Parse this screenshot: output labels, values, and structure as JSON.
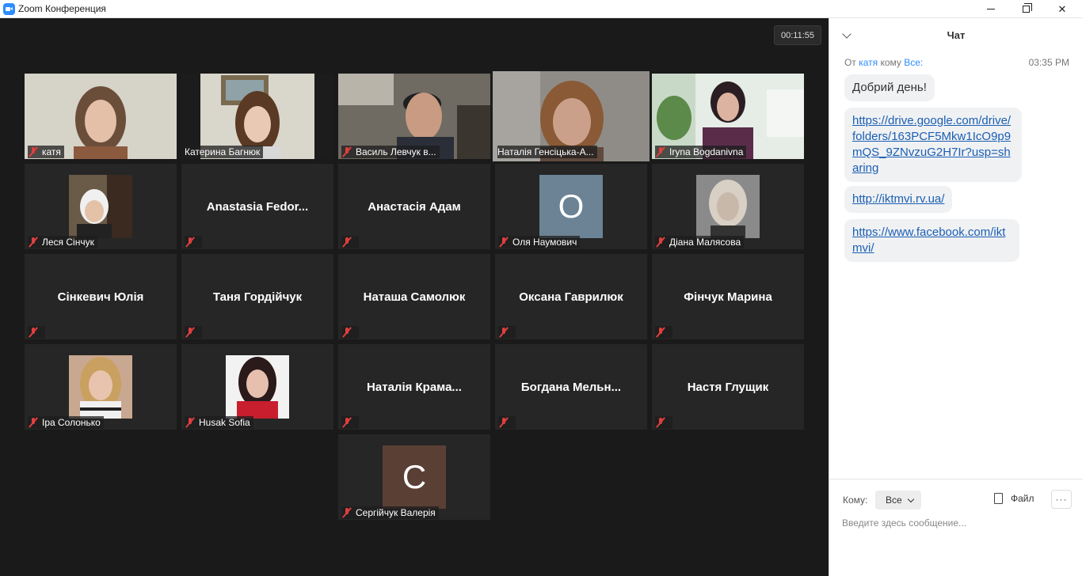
{
  "window": {
    "title": "Zoom Конференция"
  },
  "meeting": {
    "timer": "00:11:55"
  },
  "participants": [
    {
      "name": "катя",
      "video": true,
      "muted": true
    },
    {
      "name": "Катерина Багнюк",
      "video": true,
      "muted": false
    },
    {
      "name": "Василь Левчук в...",
      "video": true,
      "muted": true
    },
    {
      "name": "Наталія Генсіцька-А...",
      "video": true,
      "muted": false,
      "active": true
    },
    {
      "name": "Iryna Bogdanivna",
      "video": true,
      "muted": true
    },
    {
      "name": "Леся Сінчук",
      "video": false,
      "avatar": "photo",
      "muted": true
    },
    {
      "name": "Anastasia  Fedor...",
      "video": false,
      "muted": true
    },
    {
      "name": "Анастасія Адам",
      "video": false,
      "muted": true
    },
    {
      "name": "Оля Наумович",
      "video": false,
      "avatar": "letter",
      "letter": "O",
      "color": "#6b8394",
      "muted": true
    },
    {
      "name": "Діана Малясова",
      "video": false,
      "avatar": "photo",
      "muted": true
    },
    {
      "name": "Сінкевич Юлія",
      "video": false,
      "muted": true
    },
    {
      "name": "Таня Гордійчук",
      "video": false,
      "muted": true
    },
    {
      "name": "Наташа Самолюк",
      "video": false,
      "muted": true
    },
    {
      "name": "Оксана Гаврилюк",
      "video": false,
      "muted": true
    },
    {
      "name": "Фінчук Марина",
      "video": false,
      "muted": true
    },
    {
      "name": "Іра Солонько",
      "video": false,
      "avatar": "photo",
      "muted": true
    },
    {
      "name": "Husak Sofia",
      "video": false,
      "avatar": "photo",
      "muted": true
    },
    {
      "name": "Наталія  Крама...",
      "video": false,
      "muted": true
    },
    {
      "name": "Богдана  Мельн...",
      "video": false,
      "muted": true
    },
    {
      "name": "Настя Глущик",
      "video": false,
      "muted": true
    },
    {
      "name": "Сергійчук Валерія",
      "video": false,
      "avatar": "letter",
      "letter": "C",
      "color": "#5a3f35",
      "muted": true
    }
  ],
  "chat": {
    "title": "Чат",
    "meta": {
      "from_label": "От",
      "sender": "катя",
      "to_label": "кому",
      "recipient": "Все:",
      "time": "03:35 PM"
    },
    "messages": [
      {
        "text": "Добрий день!"
      },
      {
        "link": "https://drive.google.com/drive/folders/163PCF5Mkw1IcO9p9mQS_9ZNvzuG2H7Ir?usp=sharing"
      },
      {
        "link": "http://iktmvi.rv.ua/"
      },
      {
        "link": "https://www.facebook.com/iktmvi/"
      }
    ],
    "compose": {
      "to_label": "Кому:",
      "recipient": "Все",
      "file_label": "Файл",
      "more_label": "···",
      "placeholder": "Введите здесь сообщение..."
    }
  }
}
